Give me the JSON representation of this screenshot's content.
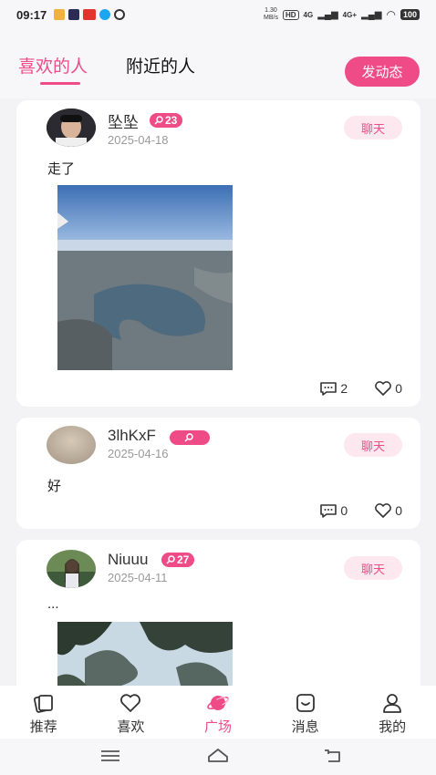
{
  "status_bar": {
    "time": "09:17",
    "net_speed_top": "1.30",
    "net_speed_bottom": "MB/s",
    "hd_label": "HD",
    "signal1": "4G",
    "signal2": "4G+",
    "battery": "100"
  },
  "tabs": [
    {
      "label": "喜欢的人",
      "active": true
    },
    {
      "label": "附近的人",
      "active": false
    }
  ],
  "post_button": "发动态",
  "posts": [
    {
      "username": "坠坠",
      "badge_count": "23",
      "date": "2025-04-18",
      "chat_label": "聊天",
      "text": "走了",
      "comments": "2",
      "likes": "0",
      "has_photo": true
    },
    {
      "username": "3lhKxF",
      "badge_count": "",
      "date": "2025-04-16",
      "chat_label": "聊天",
      "text": "好",
      "comments": "0",
      "likes": "0",
      "has_photo": false
    },
    {
      "username": "Niuuu",
      "badge_count": "27",
      "date": "2025-04-11",
      "chat_label": "聊天",
      "text": "...",
      "has_photo": true
    }
  ],
  "bottom_nav": [
    {
      "label": "推荐",
      "icon": "cards-icon"
    },
    {
      "label": "喜欢",
      "icon": "heart-icon"
    },
    {
      "label": "广场",
      "icon": "planet-icon",
      "active": true
    },
    {
      "label": "消息",
      "icon": "message-icon"
    },
    {
      "label": "我的",
      "icon": "person-icon"
    }
  ],
  "colors": {
    "accent": "#ef4b86",
    "chat_bg": "#fde8ef",
    "date": "#9a9a9a"
  }
}
